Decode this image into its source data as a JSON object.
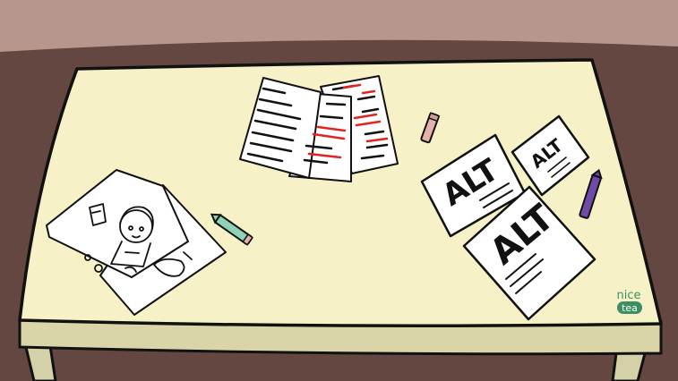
{
  "scene": {
    "colors": {
      "wall": "#b7968d",
      "floor": "#634740",
      "table_top": "#f6f1c6",
      "table_edge": "#d9d5a9",
      "table_leg": "#d4d1a8",
      "paper": "#ffffff",
      "ink": "#111111",
      "red_ink": "#e3231d",
      "crayon_pink": "#e7b1ab",
      "crayon_teal": "#8fd3b4",
      "crayon_purple": "#6f4aa6",
      "logo_green": "#3c8f62"
    },
    "alt_cards": [
      {
        "text": "ALT",
        "size": "large-left"
      },
      {
        "text": "ALT",
        "size": "small-right"
      },
      {
        "text": "ALT",
        "size": "large-bottom"
      }
    ],
    "logo": {
      "line1": "nice",
      "line2": "tea"
    }
  }
}
